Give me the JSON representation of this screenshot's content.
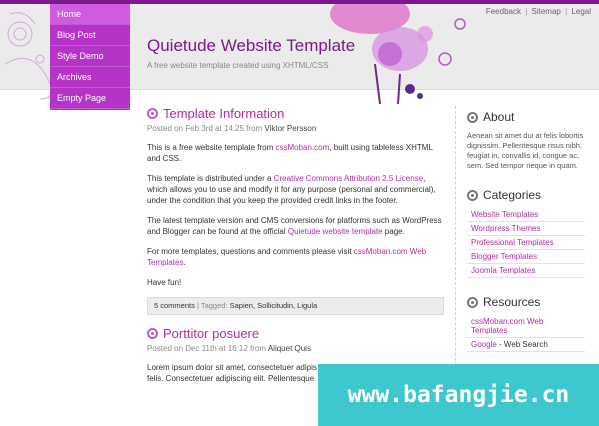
{
  "top_links": [
    "Feedback",
    "Sitemap",
    "Legal"
  ],
  "nav": [
    "Home",
    "Blog Post",
    "Style Demo",
    "Archives",
    "Empty Page"
  ],
  "site": {
    "title": "Quietude Website Template",
    "subtitle": "A free website template created using XHTML/CSS"
  },
  "post1": {
    "title": "Template Information",
    "meta_prefix": "Posted on Feb 3rd at 14:25 from ",
    "author": "Viktor Persson",
    "p1_a": "This is a free website template from ",
    "p1_link": "cssMoban.com",
    "p1_b": ", built using tableless XHTML and CSS.",
    "p2_a": "This template is distributed under a ",
    "p2_link": "Creative Commons Attribution 2.5 License",
    "p2_b": ", which allows you to use and modify it for any purpose (personal and commercial), under the condition that you keep the provided credit links in the footer.",
    "p3_a": "The latest template version and CMS conversions for platforms such as WordPress and Blogger can be found at the official ",
    "p3_link": "Quietude website template",
    "p3_b": " page.",
    "p4_a": "For more templates, questions and comments please visit ",
    "p4_link": "cssMoban.com Web Templates",
    "p4_b": ".",
    "p5": "Have fun!",
    "comments": "5 comments",
    "tagged": " | Tagged: ",
    "tags": "Sapien, Sollicitudin, Ligula"
  },
  "post2": {
    "title": "Porttitor posuere",
    "meta_prefix": "Posted on Dec 11th at 16:12 from ",
    "author": "Aliquet Quis",
    "p1": "Lorem ipsum dolor sit amet, consectetuer adipis",
    "p2": "felis. Consectetuer adipiscing elit. Pellentesque"
  },
  "sidebar": {
    "about_title": "About",
    "about_text": "Aenean sit amet dui at felis lobortis dignissim. Pellentesque risus nibh, feugiat in, convallis id, congue ac, sem. Sed tempor neque in quam.",
    "categories_title": "Categories",
    "categories": [
      "Website Templates",
      "Wordpress Themes",
      "Professional Templates",
      "Blogger Templates",
      "Joomla Templates"
    ],
    "resources_title": "Resources",
    "resource1": "cssMoban.com Web Templates",
    "resource2_link": "Google",
    "resource2_rest": " - Web Search"
  },
  "watermark": "www.bafangjie.cn",
  "colors": {
    "accent": "#b52ca0",
    "nav_bg": "#b533c6",
    "watermark_bg": "#3cc8cc"
  }
}
